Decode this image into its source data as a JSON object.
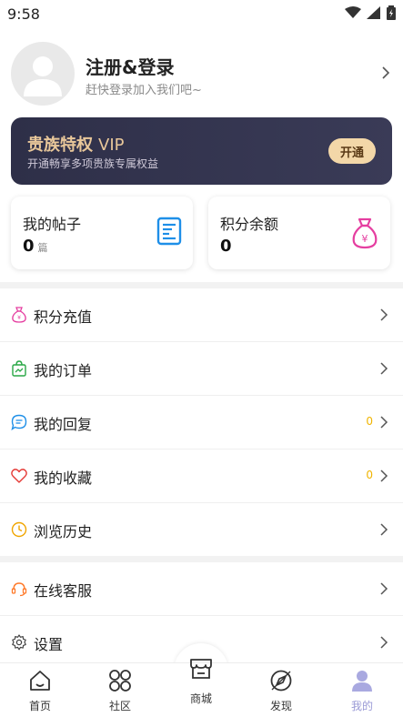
{
  "status_bar": {
    "time": "9:58"
  },
  "profile": {
    "name": "注册&登录",
    "subtitle": "赶快登录加入我们吧~"
  },
  "vip": {
    "title": "贵族特权",
    "badge": "VIP",
    "description": "开通畅享多项贵族专属权益",
    "button": "开通"
  },
  "stats": [
    {
      "label": "我的帖子",
      "value": "0",
      "unit": "篇",
      "icon": "document-icon"
    },
    {
      "label": "积分余额",
      "value": "0",
      "unit": "",
      "icon": "money-bag-icon"
    }
  ],
  "menu": [
    {
      "label": "积分充值",
      "icon": "money-bag-icon",
      "badge": ""
    },
    {
      "label": "我的订单",
      "icon": "bag-icon",
      "badge": ""
    },
    {
      "label": "我的回复",
      "icon": "chat-icon",
      "badge": "0"
    },
    {
      "label": "我的收藏",
      "icon": "heart-icon",
      "badge": "0"
    },
    {
      "label": "浏览历史",
      "icon": "clock-icon",
      "badge": ""
    },
    {
      "label": "在线客服",
      "icon": "support-icon",
      "badge": ""
    },
    {
      "label": "设置",
      "icon": "gear-icon",
      "badge": ""
    }
  ],
  "tabs": [
    {
      "label": "首页",
      "icon": "home-icon"
    },
    {
      "label": "社区",
      "icon": "community-icon"
    },
    {
      "label": "商城",
      "icon": "store-icon"
    },
    {
      "label": "发现",
      "icon": "discover-icon"
    },
    {
      "label": "我的",
      "icon": "user-icon",
      "active": true
    }
  ],
  "colors": {
    "accent_active": "#9a9ad6",
    "vip_gold": "#e8c79a",
    "badge_yellow": "#f0b400"
  }
}
